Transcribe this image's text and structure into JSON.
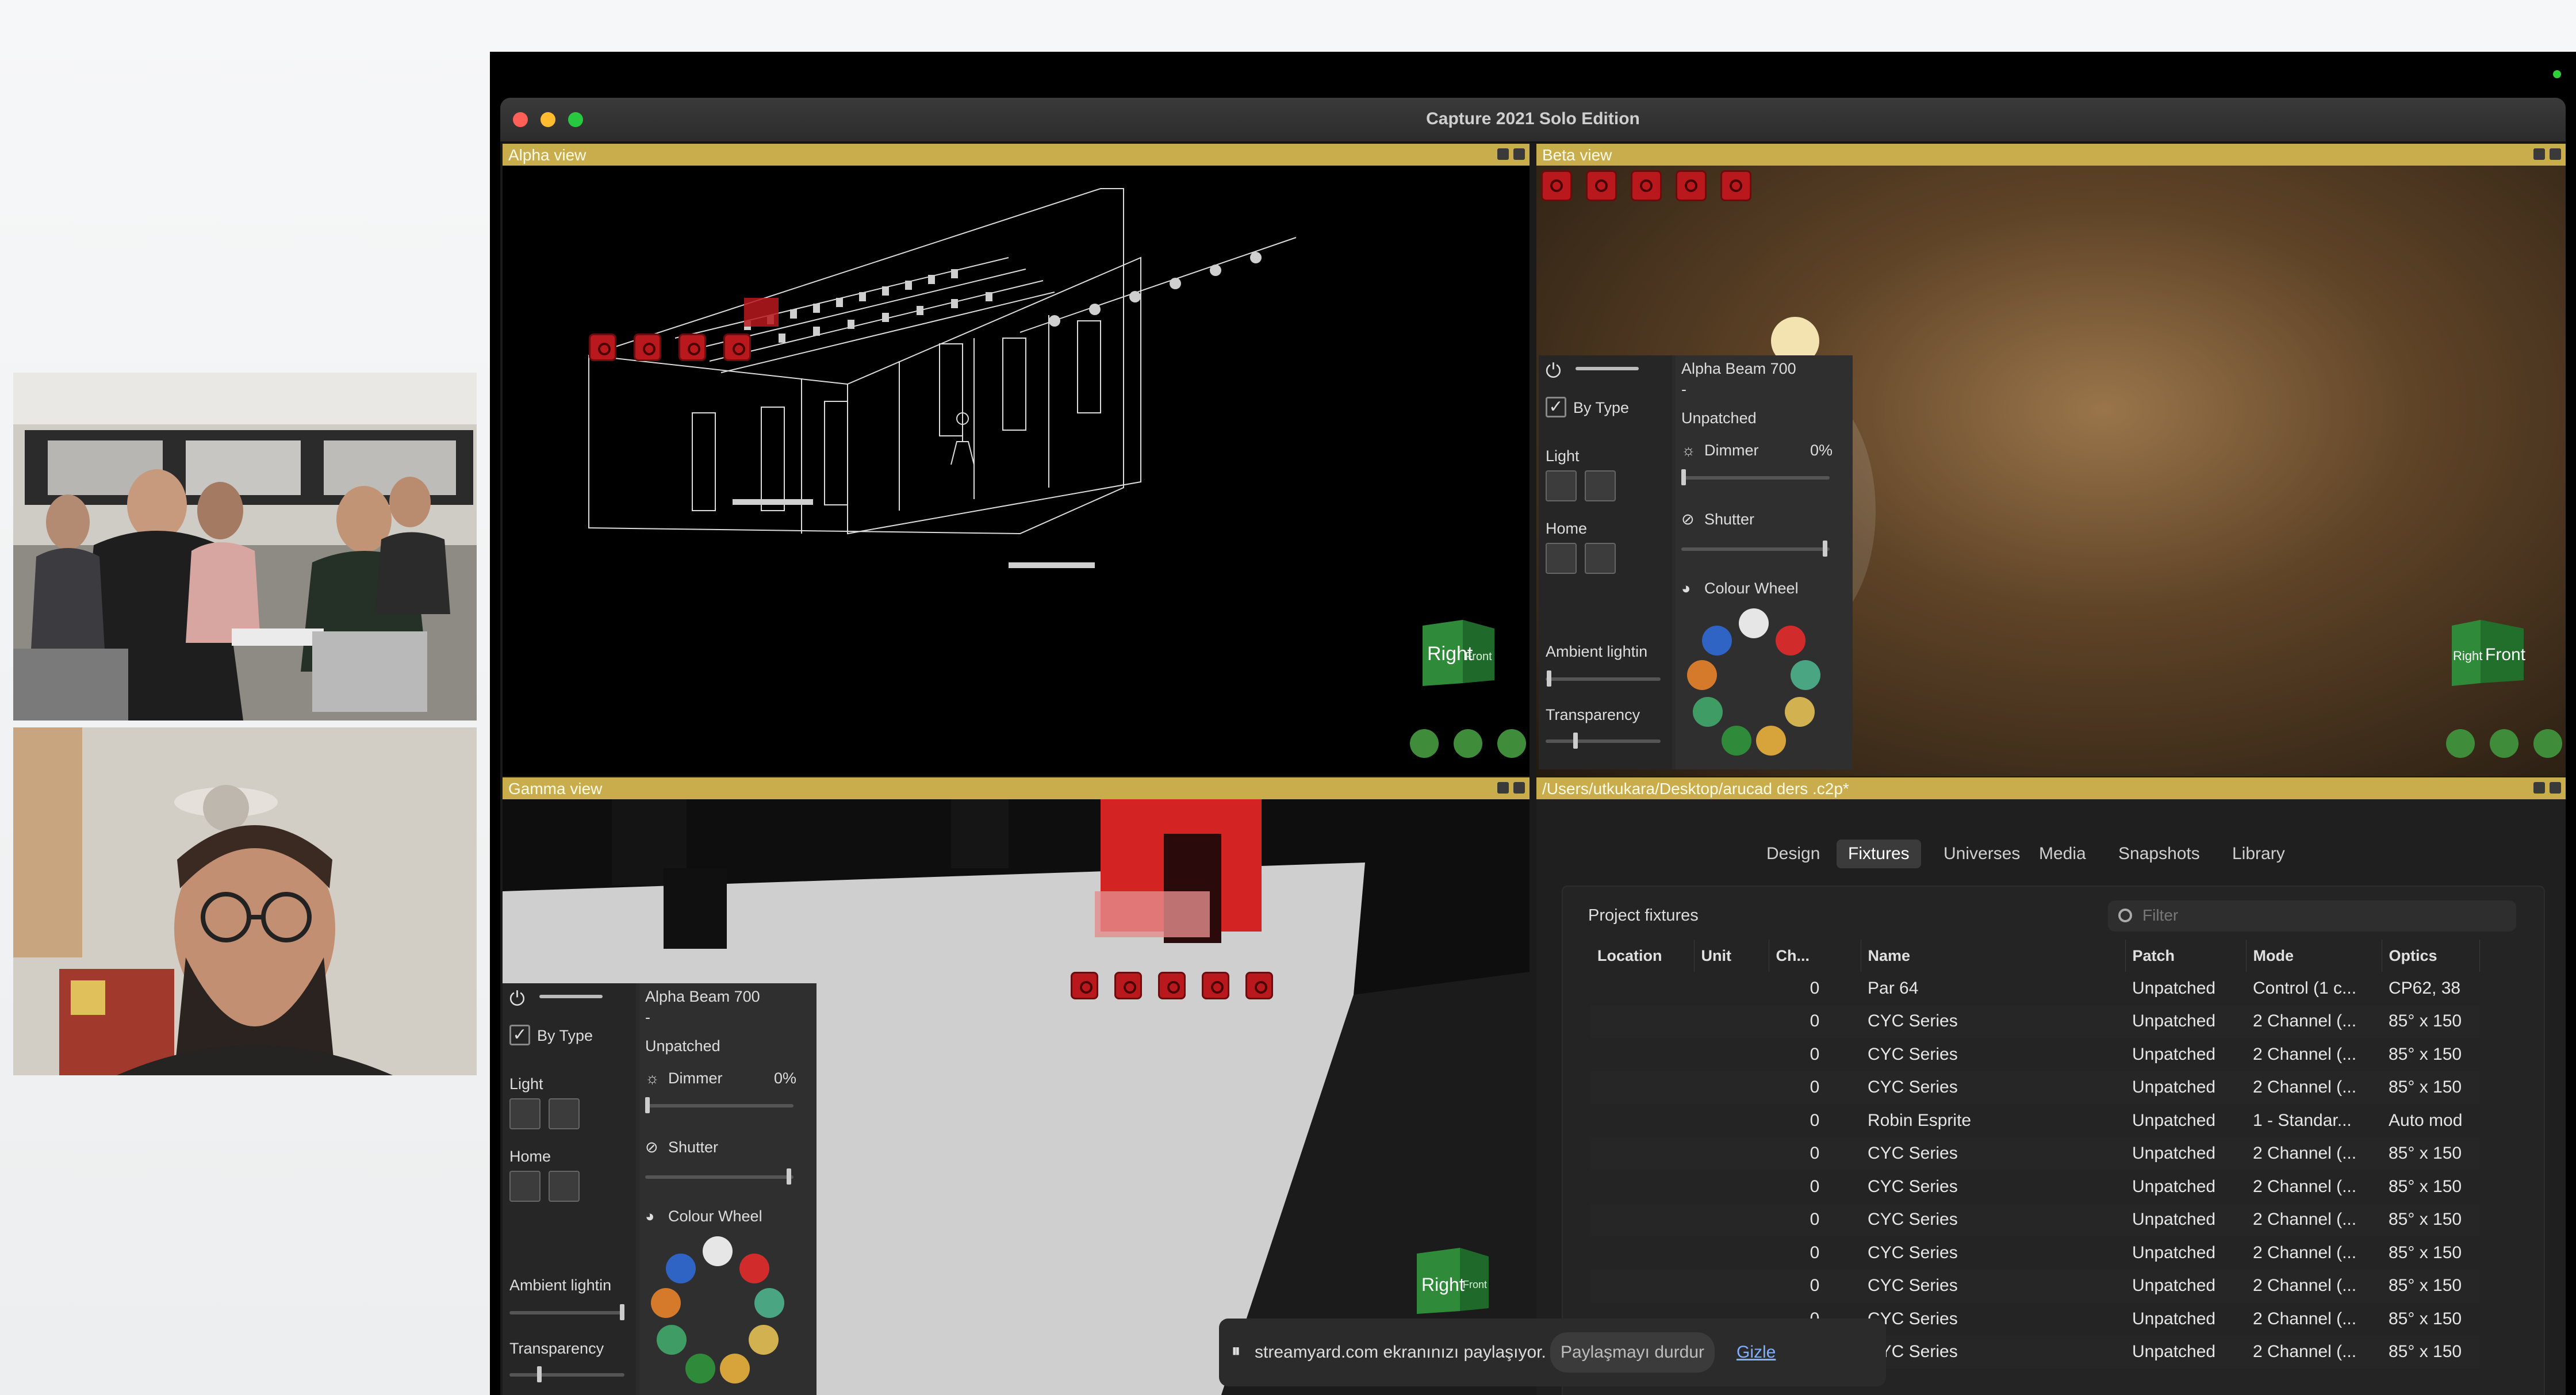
{
  "window": {
    "title": "Capture 2021 Solo Edition"
  },
  "views": {
    "alpha": {
      "title": "Alpha view"
    },
    "beta": {
      "title": "Beta view"
    },
    "gamma": {
      "title": "Gamma view"
    },
    "files": {
      "title": "/Users/utkukara/Desktop/arucad ders .c2p*"
    }
  },
  "nav_cube": {
    "right": "Right",
    "front": "Front"
  },
  "fixture_panel": {
    "fixture_name": "Alpha Beam 700",
    "dash": "-",
    "patch_status": "Unpatched",
    "by_type": "By Type",
    "light": "Light",
    "home": "Home",
    "ambient": "Ambient lightin",
    "transparency": "Transparency",
    "dimmer": "Dimmer",
    "dimmer_value": "0%",
    "shutter": "Shutter",
    "colour_wheel": "Colour Wheel"
  },
  "tabs": [
    "Design",
    "Fixtures",
    "Universes",
    "Media",
    "Snapshots",
    "Library"
  ],
  "active_tab": "Fixtures",
  "project_fixtures": {
    "title": "Project fixtures",
    "filter_placeholder": "Filter",
    "columns": [
      "Location",
      "Unit",
      "Ch...",
      "Name",
      "Patch",
      "Mode",
      "Optics"
    ],
    "rows": [
      [
        "",
        "",
        "0",
        "Par 64",
        "Unpatched",
        "Control (1 c...",
        "CP62, 38"
      ],
      [
        "",
        "",
        "0",
        "CYC Series",
        "Unpatched",
        "2 Channel (...",
        "85° x 150"
      ],
      [
        "",
        "",
        "0",
        "CYC Series",
        "Unpatched",
        "2 Channel (...",
        "85° x 150"
      ],
      [
        "",
        "",
        "0",
        "CYC Series",
        "Unpatched",
        "2 Channel (...",
        "85° x 150"
      ],
      [
        "",
        "",
        "0",
        "Robin Esprite",
        "Unpatched",
        "1 - Standar...",
        "Auto mod"
      ],
      [
        "",
        "",
        "0",
        "CYC Series",
        "Unpatched",
        "2 Channel (...",
        "85° x 150"
      ],
      [
        "",
        "",
        "0",
        "CYC Series",
        "Unpatched",
        "2 Channel (...",
        "85° x 150"
      ],
      [
        "",
        "",
        "0",
        "CYC Series",
        "Unpatched",
        "2 Channel (...",
        "85° x 150"
      ],
      [
        "",
        "",
        "0",
        "CYC Series",
        "Unpatched",
        "2 Channel (...",
        "85° x 150"
      ],
      [
        "",
        "",
        "0",
        "CYC Series",
        "Unpatched",
        "2 Channel (...",
        "85° x 150"
      ],
      [
        "",
        "",
        "0",
        "CYC Series",
        "Unpatched",
        "2 Channel (...",
        "85° x 150"
      ],
      [
        "",
        "",
        "0",
        "CYC Series",
        "Unpatched",
        "2 Channel (...",
        "85° x 150"
      ]
    ]
  },
  "share_bar": {
    "message": "streamyard.com ekranınızı paylaşıyor.",
    "stop_label": "Paylaşmayı durdur",
    "hide_label": "Gizle"
  },
  "colors": {
    "header_gold": "#c9ad4d",
    "record_red": "#b9191d",
    "nav_green": "#3f8d3a"
  }
}
